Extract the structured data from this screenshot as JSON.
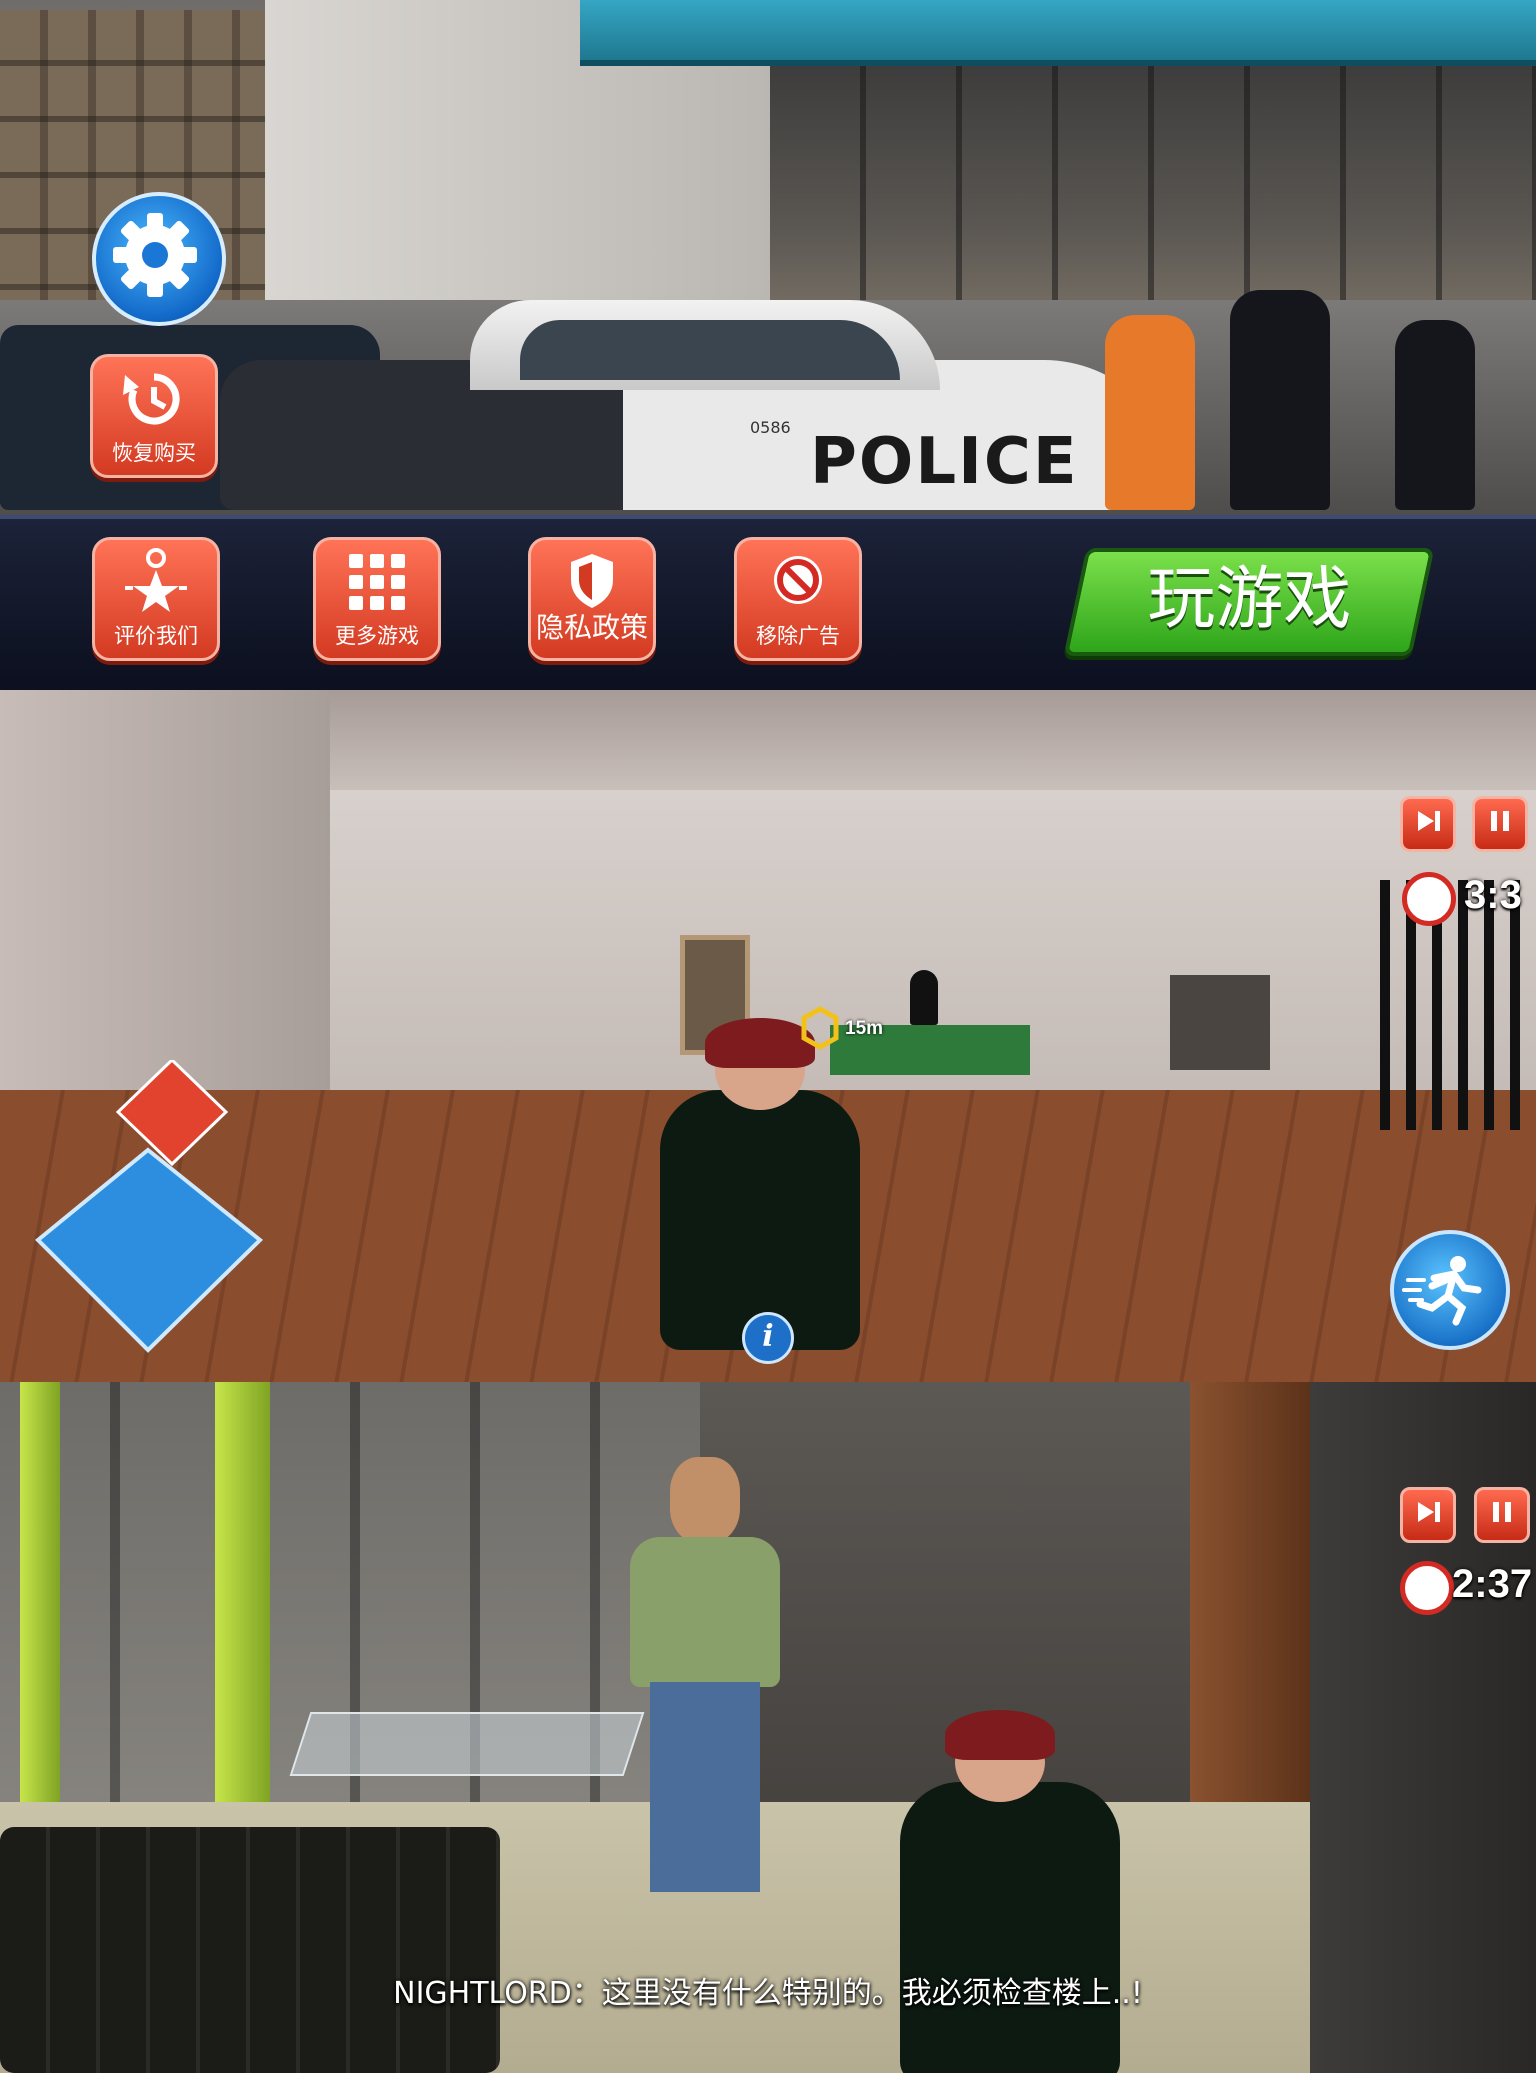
{
  "menu": {
    "restore_label": "恢复购买",
    "rate_label": "评价我们",
    "more_label": "更多游戏",
    "privacy_label": "隐私政策",
    "remove_ads_label": "移除广告",
    "play_label": "玩游戏",
    "car_text": "POLICE",
    "car_number": "0586"
  },
  "hud1": {
    "timer": "3:3",
    "waypoint_distance": "15m"
  },
  "hud2": {
    "timer": "2:37"
  },
  "subtitle": {
    "text": "NIGHTLORD：这里没有什么特别的。我必须检查楼上..!"
  },
  "colors": {
    "accent_red": "#d33a22",
    "play_green": "#2ea51a",
    "settings_blue": "#1269c8"
  }
}
